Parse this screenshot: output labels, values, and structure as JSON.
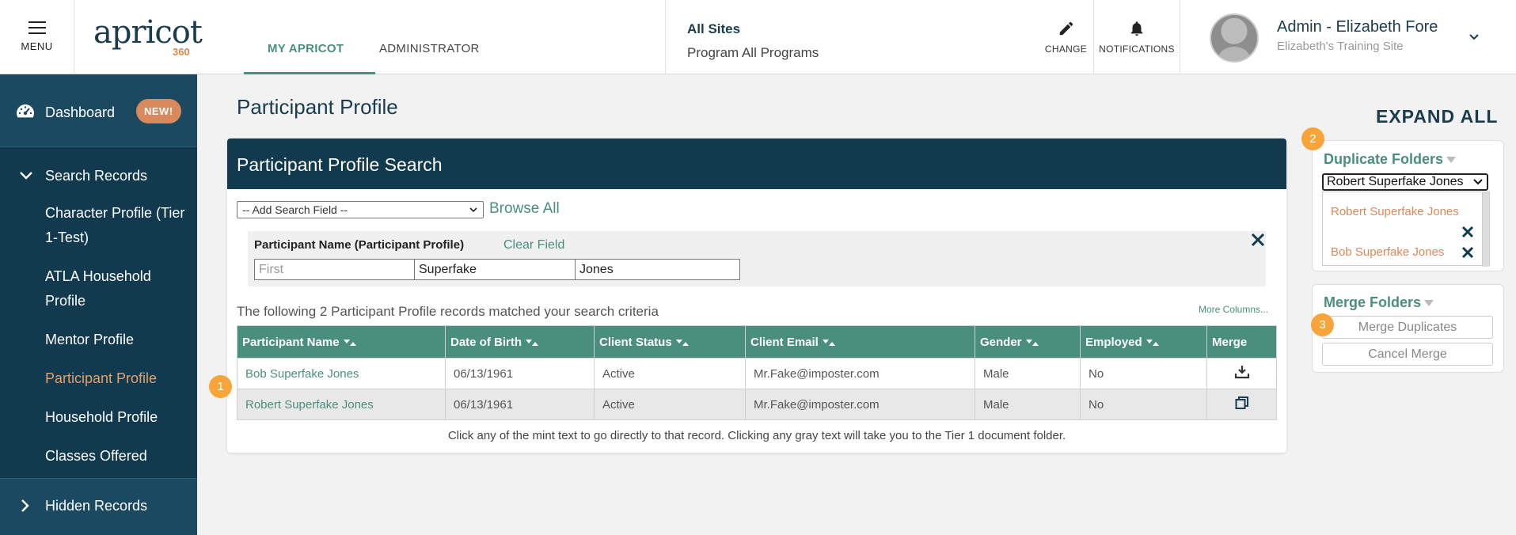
{
  "header": {
    "menu_label": "MENU",
    "logo_text": "apricot",
    "logo_suffix": "360",
    "tabs": [
      {
        "label": "MY APRICOT",
        "active": true
      },
      {
        "label": "ADMINISTRATOR",
        "active": false
      }
    ],
    "sites_title": "All Sites",
    "sites_program": "Program All Programs",
    "change_label": "CHANGE",
    "notifications_label": "NOTIFICATIONS",
    "user_name": "Admin - Elizabeth Fore",
    "user_site": "Elizabeth's Training Site"
  },
  "sidebar": {
    "dashboard_label": "Dashboard",
    "new_badge": "NEW!",
    "search_records_label": "Search Records",
    "items": [
      {
        "label": "Character Profile (Tier 1-Test)"
      },
      {
        "label": "ATLA Household Profile"
      },
      {
        "label": "Mentor Profile"
      },
      {
        "label": "Participant Profile",
        "current": true
      },
      {
        "label": "Household Profile"
      },
      {
        "label": "Classes Offered"
      }
    ],
    "hidden_records_label": "Hidden Records"
  },
  "main": {
    "page_title": "Participant Profile",
    "card_title": "Participant Profile Search",
    "add_search_field": "-- Add Search Field --",
    "browse_all": "Browse All",
    "filter": {
      "label": "Participant Name (Participant Profile)",
      "clear_field": "Clear Field",
      "first_placeholder": "First",
      "first_value": "",
      "middle_value": "Superfake",
      "last_value": "Jones"
    },
    "result_text": "The following 2 Participant Profile records matched your search criteria",
    "more_columns": "More Columns...",
    "columns": [
      "Participant Name",
      "Date of Birth",
      "Client Status",
      "Client Email",
      "Gender",
      "Employed",
      "Merge"
    ],
    "rows": [
      {
        "name": "Bob Superfake Jones",
        "dob": "06/13/1961",
        "status": "Active",
        "email": "Mr.Fake@imposter.com",
        "gender": "Male",
        "employed": "No",
        "merge_icon": "download-icon"
      },
      {
        "name": "Robert Superfake Jones",
        "dob": "06/13/1961",
        "status": "Active",
        "email": "Mr.Fake@imposter.com",
        "gender": "Male",
        "employed": "No",
        "merge_icon": "window-restore-icon"
      }
    ],
    "footnote": "Click any of the mint text to go directly to that record. Clicking any gray text will take you to the Tier 1 document folder."
  },
  "right": {
    "expand_all": "EXPAND ALL",
    "duplicate_title": "Duplicate Folders",
    "duplicate_selected": "Robert Superfake Jones",
    "duplicate_list": [
      "Robert Superfake Jones",
      "Bob Superfake Jones"
    ],
    "merge_title": "Merge Folders",
    "merge_button": "Merge Duplicates",
    "cancel_button": "Cancel Merge"
  },
  "steps": [
    "1",
    "2",
    "3"
  ],
  "colors": {
    "navy": "#123a4e",
    "mint": "#4a8f7e",
    "apricot": "#d9895c",
    "step": "#f7a53b"
  }
}
